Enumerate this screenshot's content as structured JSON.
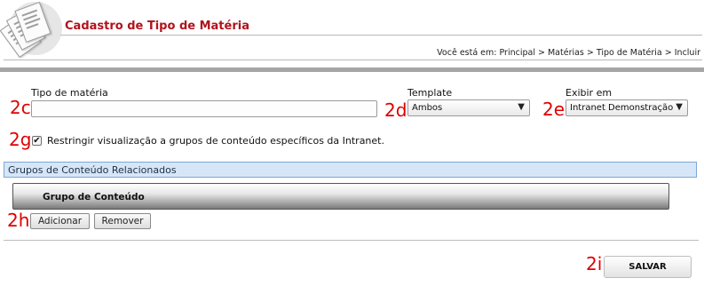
{
  "header": {
    "title": "Cadastro de Tipo de Matéria",
    "breadcrumb": "Você está em: Principal > Matérias > Tipo de Matéria > Incluir"
  },
  "annotations": {
    "a2c": "2c",
    "a2d": "2d",
    "a2e": "2e",
    "a2g": "2g",
    "a2h": "2h",
    "a2i": "2i"
  },
  "form": {
    "tipo_materia": {
      "label": "Tipo de matéria",
      "value": ""
    },
    "template": {
      "label": "Template",
      "value": "Ambos"
    },
    "exibir_em": {
      "label": "Exibir em",
      "value": "Intranet Demonstração"
    },
    "restringir": {
      "label": "Restringir visualização a grupos de conteúdo específicos da Intranet.",
      "checked": true
    }
  },
  "grupos": {
    "section_title": "Grupos de Conteúdo Relacionados",
    "columns": [
      "Grupo de Conteúdo"
    ],
    "add_label": "Adicionar",
    "remove_label": "Remover"
  },
  "actions": {
    "save_label": "SALVAR"
  },
  "icons": {
    "logo": "documents-stack-icon",
    "dropdown_arrow": "triangle-down-icon",
    "checkmark": "checkmark-icon"
  }
}
